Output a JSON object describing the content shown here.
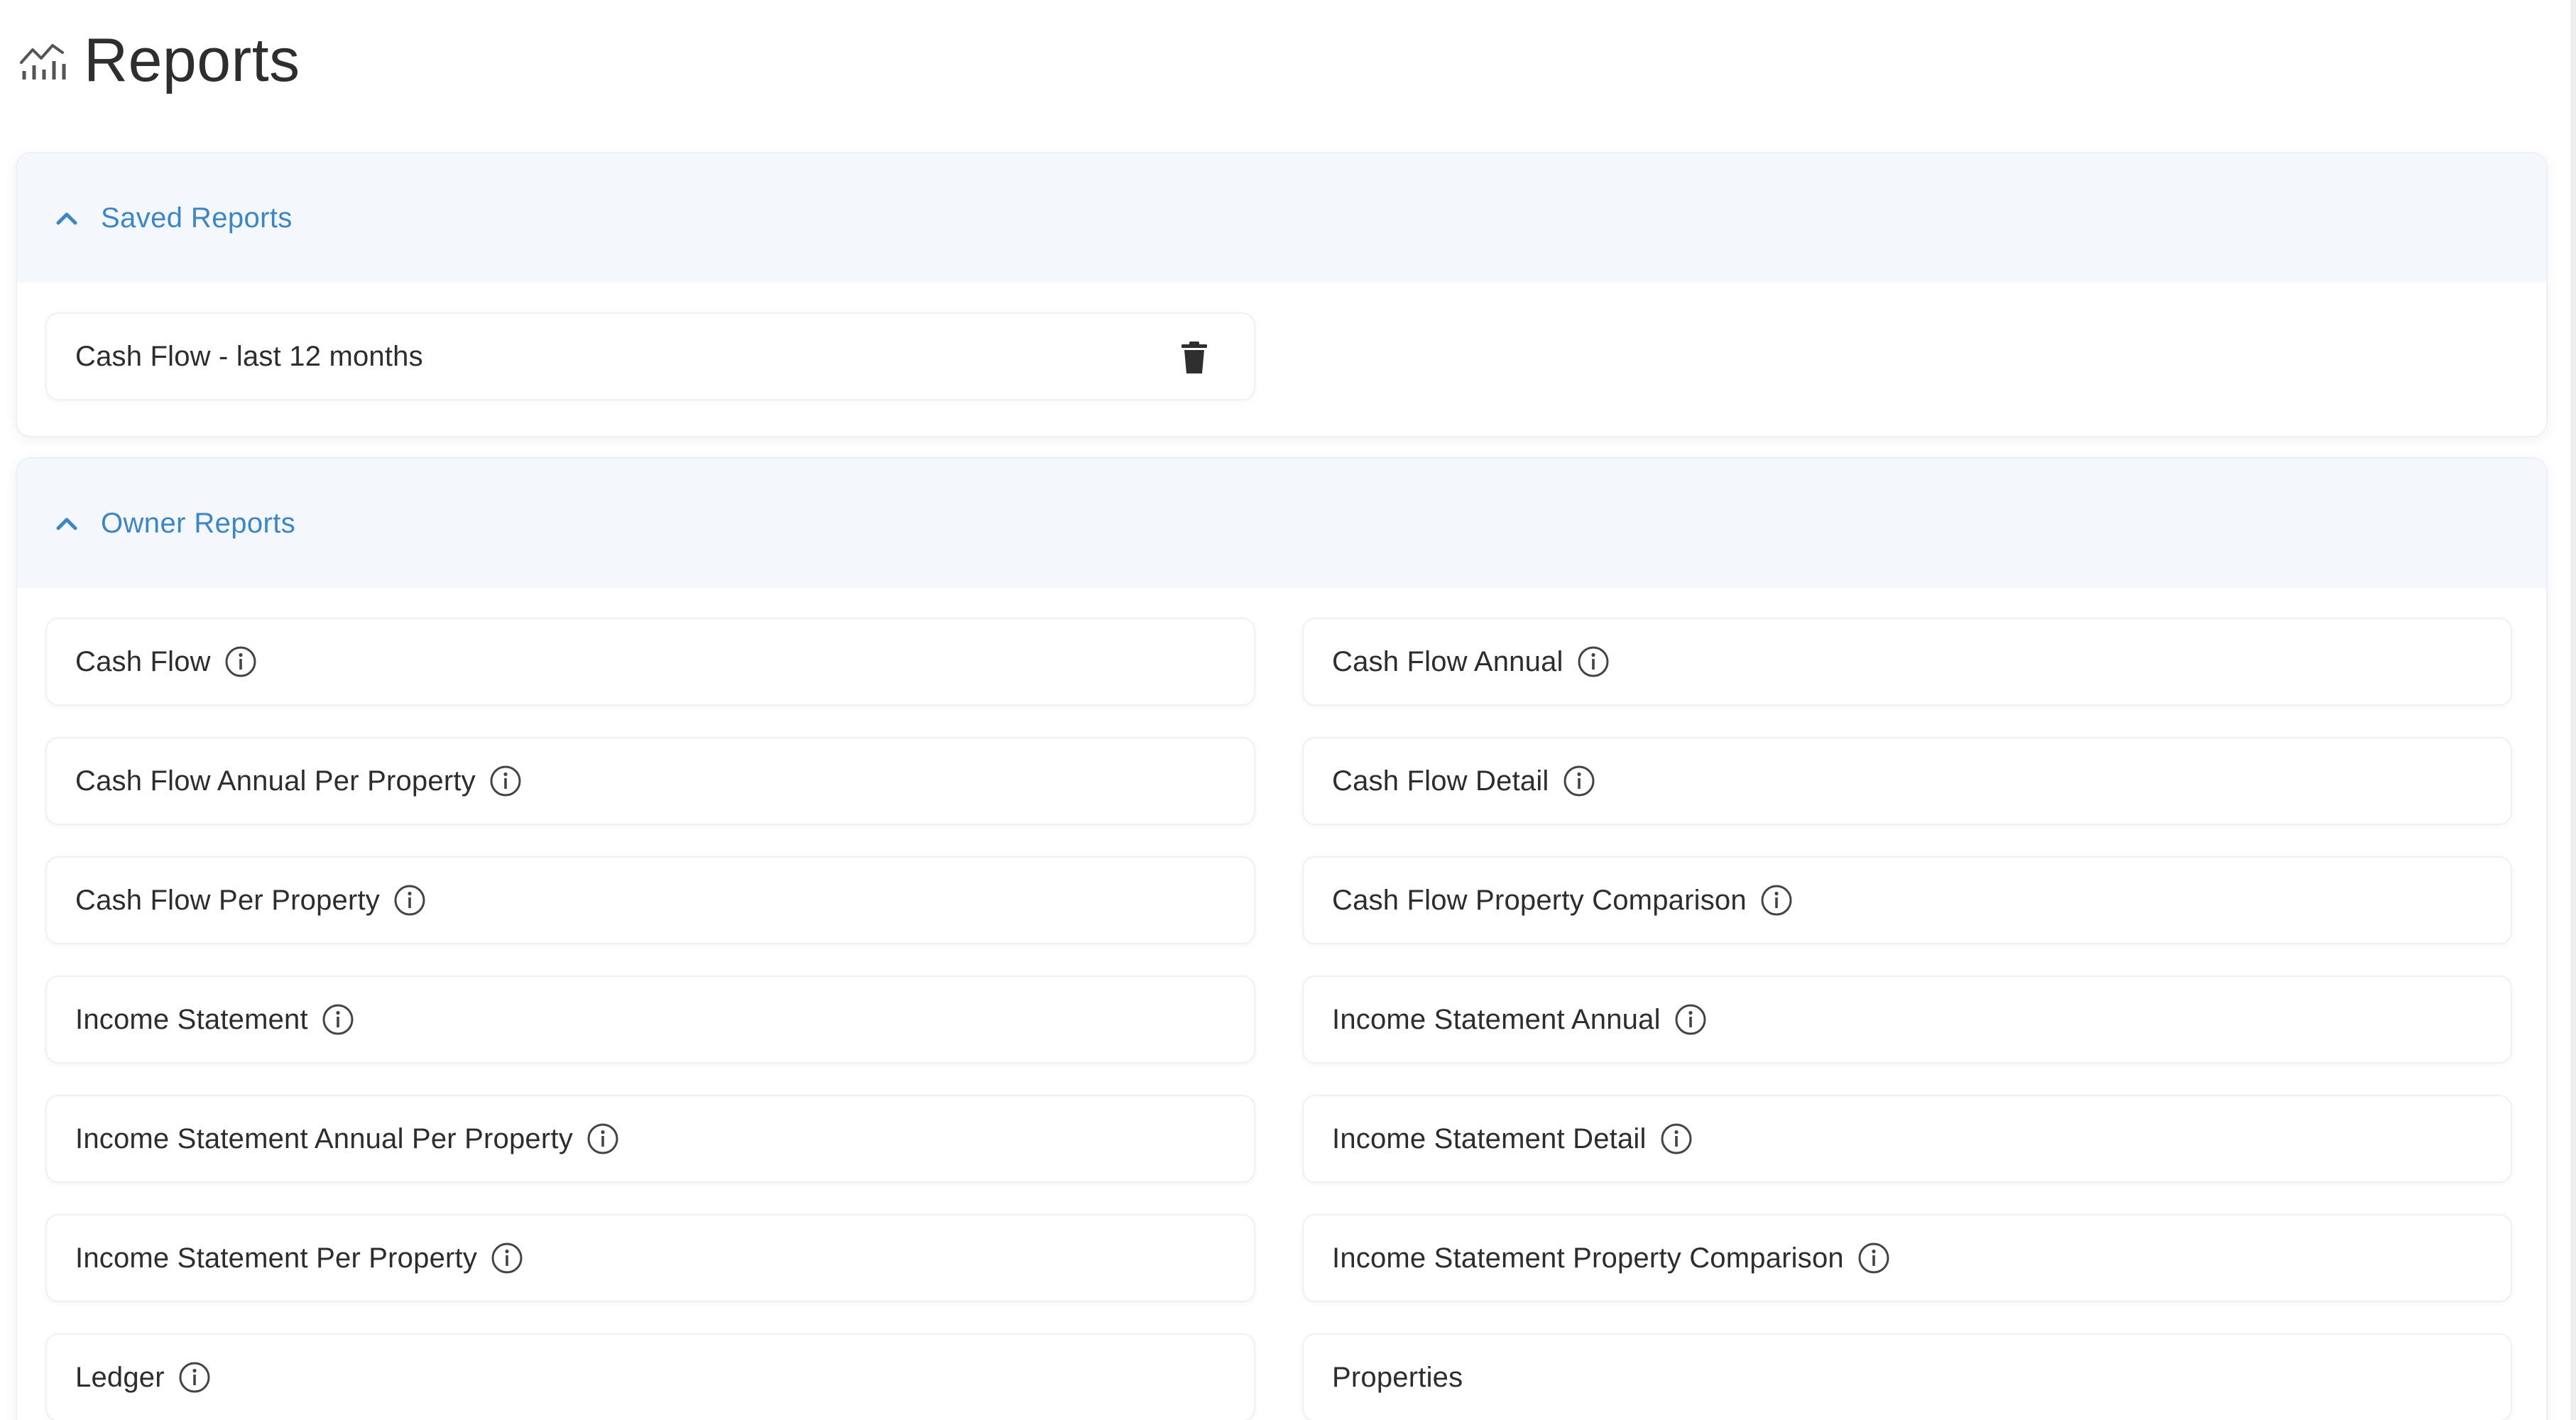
{
  "page": {
    "title": "Reports"
  },
  "saved_reports": {
    "title": "Saved Reports",
    "items": [
      {
        "label": "Cash Flow - last 12 months"
      }
    ]
  },
  "owner_reports": {
    "title": "Owner Reports",
    "left_column": [
      {
        "label": "Cash Flow",
        "info": true
      },
      {
        "label": "Cash Flow Annual Per Property",
        "info": true
      },
      {
        "label": "Cash Flow Per Property",
        "info": true
      },
      {
        "label": "Income Statement",
        "info": true
      },
      {
        "label": "Income Statement Annual Per Property",
        "info": true
      },
      {
        "label": "Income Statement Per Property",
        "info": true
      },
      {
        "label": "Ledger",
        "info": true
      }
    ],
    "right_column": [
      {
        "label": "Cash Flow Annual",
        "info": true
      },
      {
        "label": "Cash Flow Detail",
        "info": true
      },
      {
        "label": "Cash Flow Property Comparison",
        "info": true
      },
      {
        "label": "Income Statement Annual",
        "info": true
      },
      {
        "label": "Income Statement Detail",
        "info": true
      },
      {
        "label": "Income Statement Property Comparison",
        "info": true
      },
      {
        "label": "Properties",
        "info": false
      }
    ]
  },
  "colors": {
    "accent": "#3d86c6",
    "section_header_bg": "#f4f8fc",
    "text": "#2d2d2d"
  },
  "icons": {
    "header": "chart-icon",
    "section_toggle": "chevron-up-icon",
    "info": "info-icon",
    "delete": "trash-icon"
  }
}
